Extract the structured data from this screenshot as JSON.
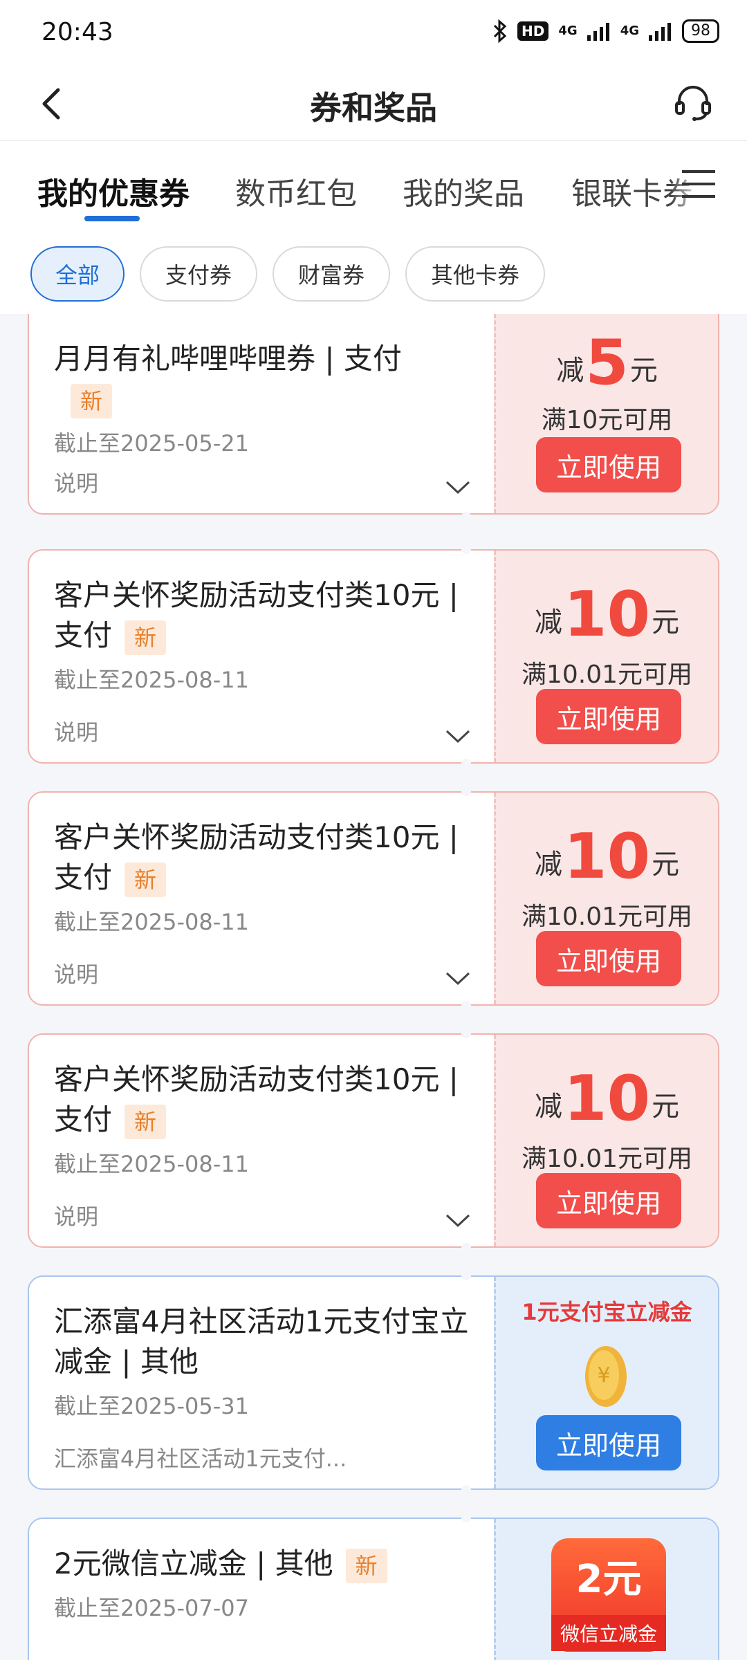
{
  "status_bar": {
    "time": "20:43",
    "network1": "4G",
    "network2": "4G",
    "hd": "HD",
    "battery": "98"
  },
  "header": {
    "title": "券和奖品"
  },
  "tabs": [
    {
      "label": "我的优惠券"
    },
    {
      "label": "数币红包"
    },
    {
      "label": "我的奖品"
    },
    {
      "label": "银联卡券"
    }
  ],
  "filters": [
    {
      "label": "全部"
    },
    {
      "label": "支付券"
    },
    {
      "label": "财富券"
    },
    {
      "label": "其他卡券"
    }
  ],
  "coupons": [
    {
      "title": "月月有礼哔哩哔哩券 | 支付",
      "tag": "新",
      "expiry": "截止至2025-05-21",
      "desc": "说明",
      "prefix": "减",
      "amount": "5",
      "unit": "元",
      "condition": "满10元可用",
      "button": "立即使用"
    },
    {
      "title": "客户关怀奖励活动支付类10元 | 支付",
      "tag": "新",
      "expiry": "截止至2025-08-11",
      "desc": "说明",
      "prefix": "减",
      "amount": "10",
      "unit": "元",
      "condition": "满10.01元可用",
      "button": "立即使用"
    },
    {
      "title": "客户关怀奖励活动支付类10元 | 支付",
      "tag": "新",
      "expiry": "截止至2025-08-11",
      "desc": "说明",
      "prefix": "减",
      "amount": "10",
      "unit": "元",
      "condition": "满10.01元可用",
      "button": "立即使用"
    },
    {
      "title": "客户关怀奖励活动支付类10元 | 支付",
      "tag": "新",
      "expiry": "截止至2025-08-11",
      "desc": "说明",
      "prefix": "减",
      "amount": "10",
      "unit": "元",
      "condition": "满10.01元可用",
      "button": "立即使用"
    },
    {
      "title": "汇添富4月社区活动1元支付宝立减金 | 其他",
      "expiry": "截止至2025-05-31",
      "desc": "汇添富4月社区活动1元支付...",
      "promo": "1元支付宝立减金",
      "button": "立即使用"
    },
    {
      "title": "2元微信立减金 | 其他",
      "tag": "新",
      "expiry": "截止至2025-07-07",
      "badge_amount": "2元",
      "badge_label": "微信立减金"
    }
  ],
  "colors": {
    "accent_blue": "#1f6fd6",
    "coupon_red": "#f24e4b",
    "new_tag": "#e8802c"
  }
}
